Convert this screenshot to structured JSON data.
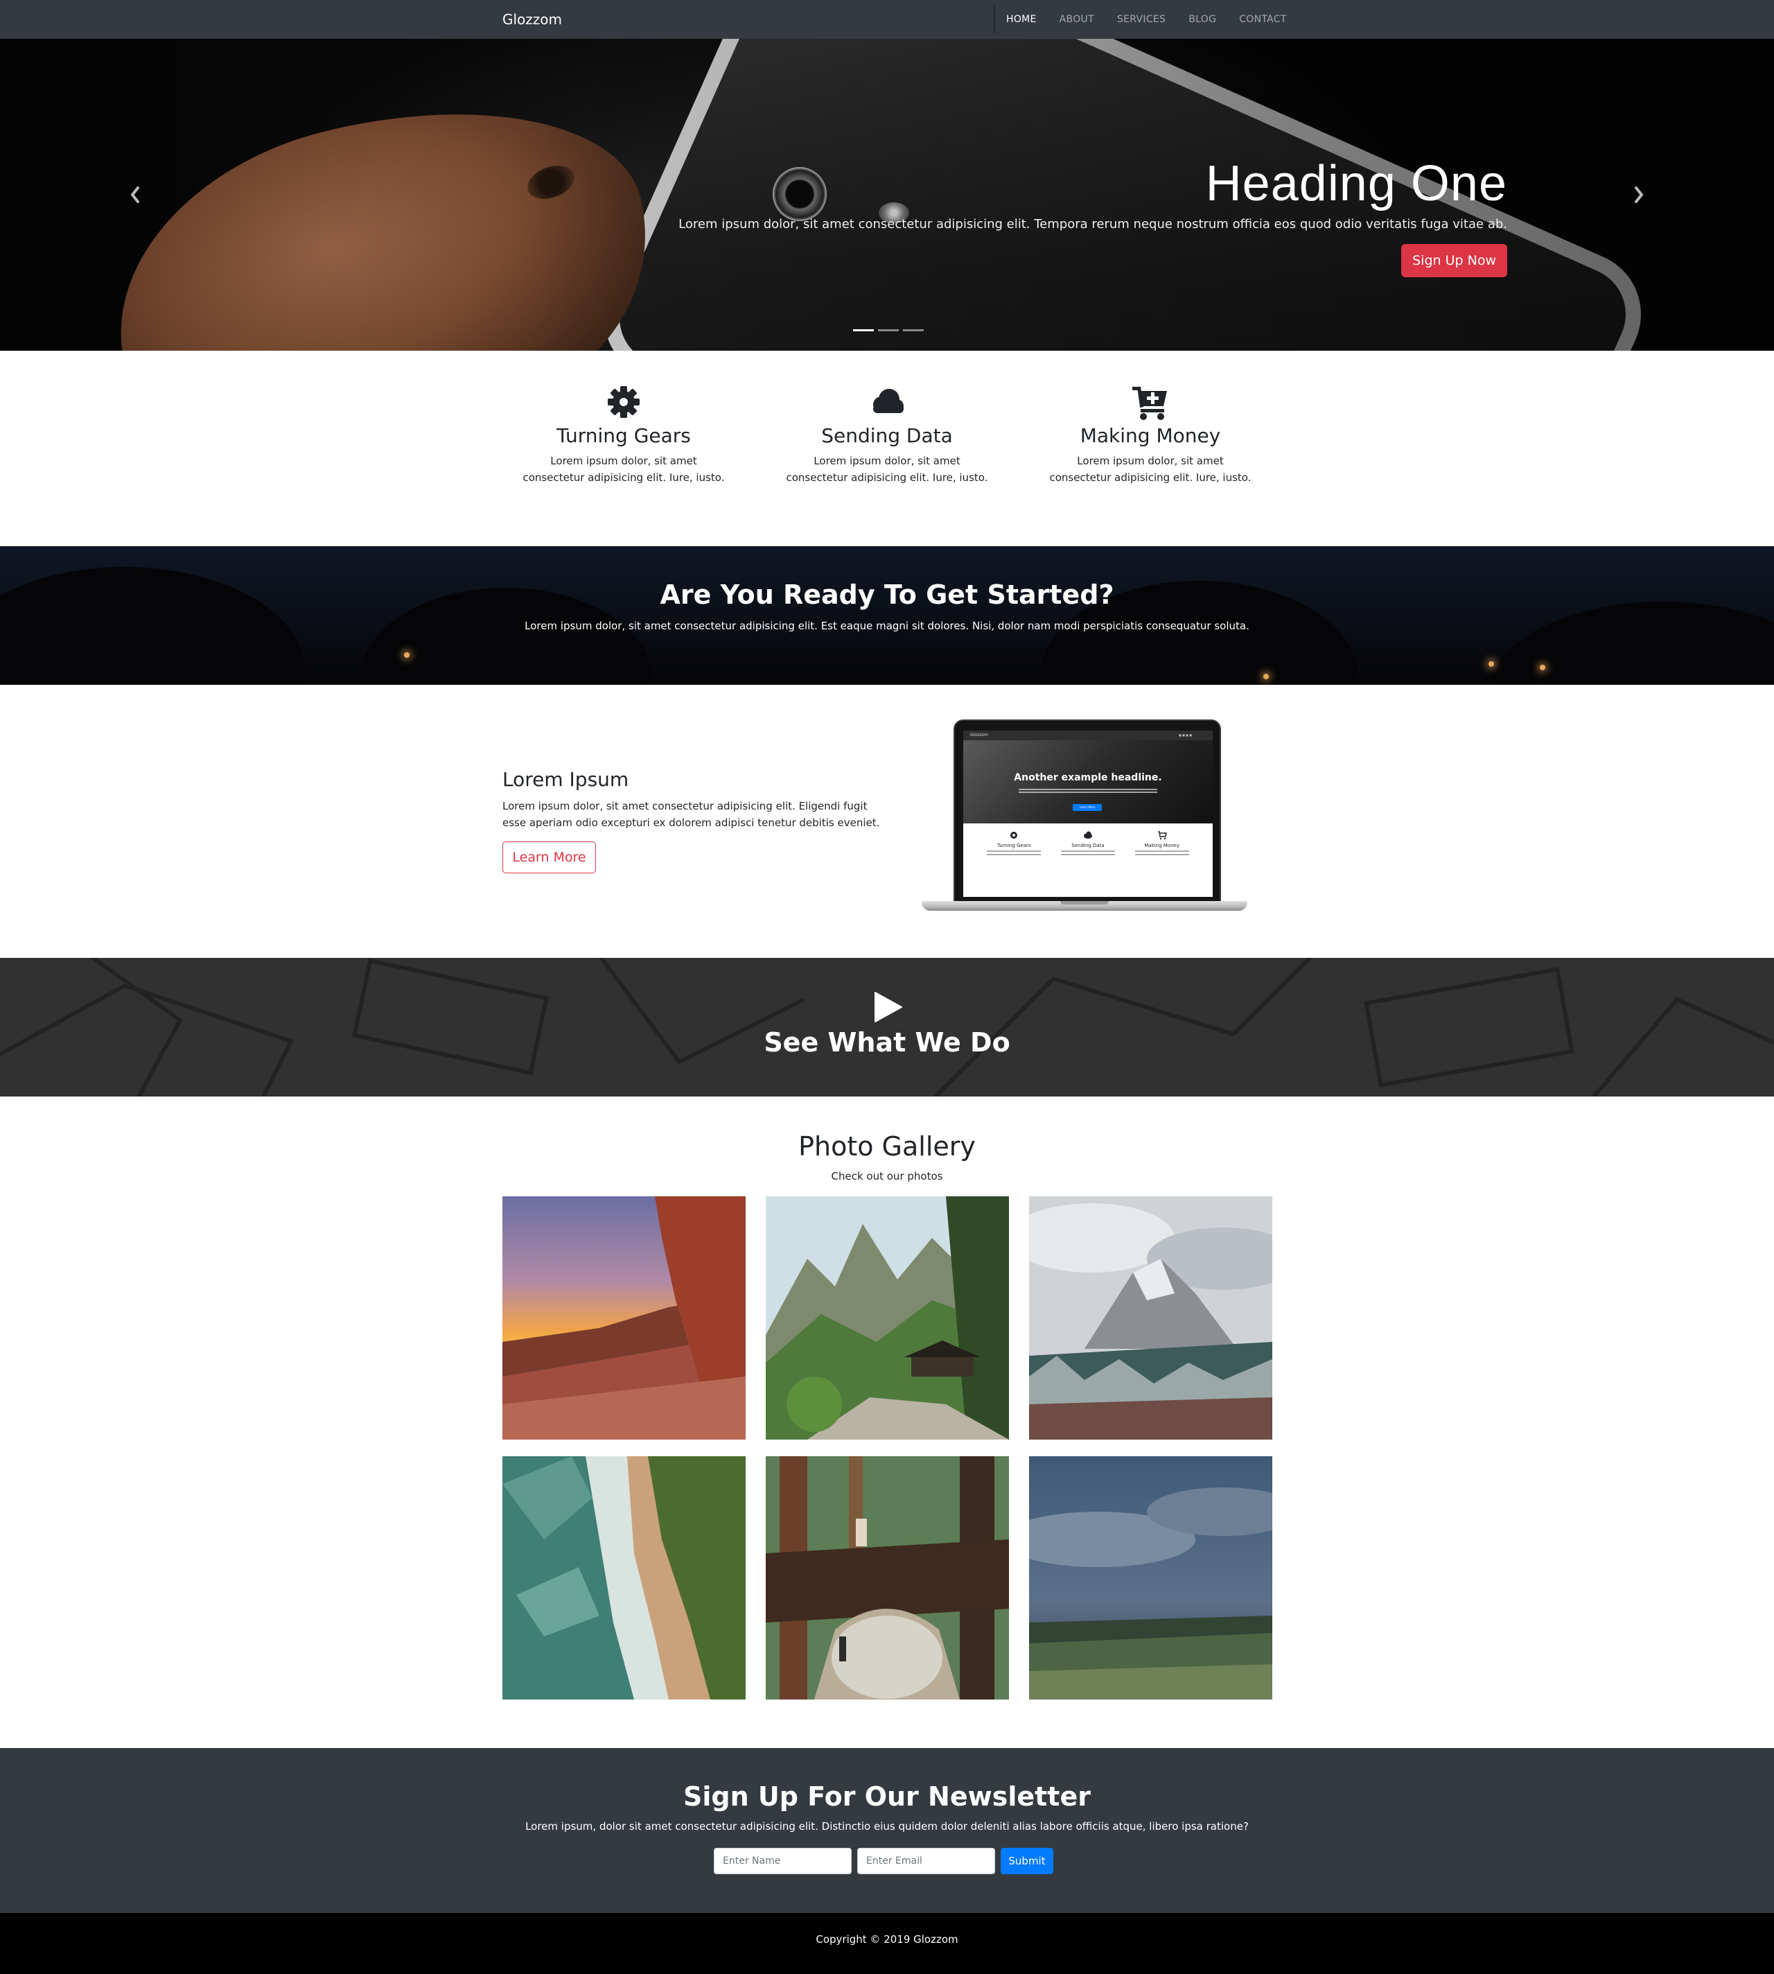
{
  "navbar": {
    "brand": "Glozzom",
    "links": [
      {
        "label": "HOME",
        "active": true
      },
      {
        "label": "ABOUT",
        "active": false
      },
      {
        "label": "SERVICES",
        "active": false
      },
      {
        "label": "BLOG",
        "active": false
      },
      {
        "label": "CONTACT",
        "active": false
      }
    ]
  },
  "hero": {
    "heading": "Heading One",
    "text": "Lorem ipsum dolor, sit amet consectetur adipisicing elit. Tempora rerum neque nostrum officia eos quod odio veritatis fuga vitae ab.",
    "button_label": "Sign Up Now",
    "prev_icon": "chevron-left-icon",
    "next_icon": "chevron-right-icon",
    "indicator_count": 3,
    "active_indicator": 1
  },
  "features": [
    {
      "icon": "gear-icon",
      "title": "Turning Gears",
      "text": "Lorem ipsum dolor, sit amet consectetur adipisicing elit. Iure, iusto."
    },
    {
      "icon": "cloud-icon",
      "title": "Sending Data",
      "text": "Lorem ipsum dolor, sit amet consectetur adipisicing elit. Iure, iusto."
    },
    {
      "icon": "cart-plus-icon",
      "title": "Making Money",
      "text": "Lorem ipsum dolor, sit amet consectetur adipisicing elit. Iure, iusto."
    }
  ],
  "cta": {
    "title": "Are You Ready To Get Started?",
    "text": "Lorem ipsum dolor, sit amet consectetur adipisicing elit. Est eaque magni sit dolores. Nisi, dolor nam modi perspiciatis consequatur soluta."
  },
  "info": {
    "heading": "Lorem Ipsum",
    "text": "Lorem ipsum dolor, sit amet consectetur adipisicing elit. Eligendi fugit esse aperiam odio excepturi ex dolorem adipisci tenetur debitis eveniet.",
    "button_label": "Learn More",
    "laptop_screen": {
      "brand": "Glozzom",
      "headline": "Another example headline.",
      "button_label": "Learn More",
      "features": [
        "Turning Gears",
        "Sending Data",
        "Making Money"
      ]
    }
  },
  "video": {
    "title": "See What We Do",
    "icon": "play-icon"
  },
  "gallery": {
    "title": "Photo Gallery",
    "subtitle": "Check out our photos",
    "photos": [
      "canyon-sunset",
      "mountain-temple",
      "snowy-peak",
      "coastline-aerial",
      "forest-log-tunnel",
      "storm-field"
    ]
  },
  "newsletter": {
    "title": "Sign Up For Our Newsletter",
    "text": "Lorem ipsum, dolor sit amet consectetur adipisicing elit. Distinctio eius quidem dolor deleniti alias labore officiis atque, libero ipsa ratione?",
    "name_placeholder": "Enter Name",
    "email_placeholder": "Enter Email",
    "submit_label": "Submit"
  },
  "footer": {
    "copyright": "Copyright © 2019 Glozzom"
  },
  "colors": {
    "navbar": "#343a40",
    "danger": "#dc3545",
    "primary": "#007bff",
    "footer": "#000000"
  }
}
